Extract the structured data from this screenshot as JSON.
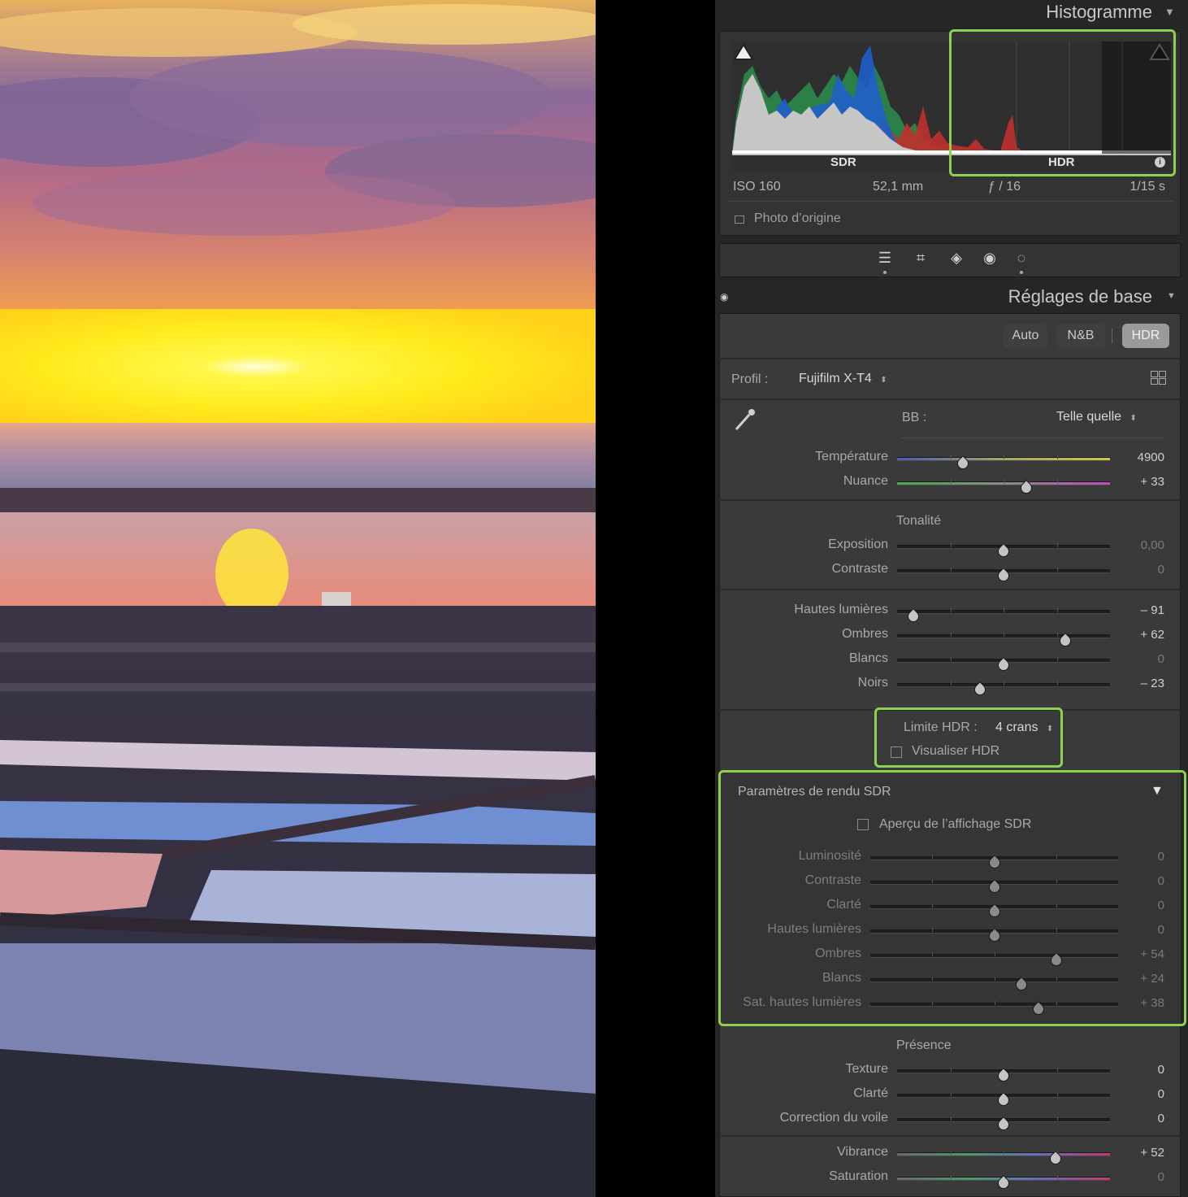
{
  "histogram": {
    "title": "Histogramme",
    "sdr_label": "SDR",
    "hdr_label": "HDR",
    "info": {
      "iso": "ISO 160",
      "focal": "52,1 mm",
      "aperture": "ƒ / 16",
      "shutter": "1/15 s"
    },
    "original_photo_label": "Photo d’origine"
  },
  "basic": {
    "title": "Réglages de base",
    "buttons": [
      "Auto",
      "N&B",
      "HDR"
    ],
    "profile_label": "Profil :",
    "profile_value": "Fujifilm X-T4",
    "wb_label": "BB :",
    "wb_value": "Telle quelle",
    "wb_sliders": [
      {
        "label": "Température",
        "value": "4900",
        "pos": 0.31
      },
      {
        "label": "Nuance",
        "value": "+ 33",
        "pos": 0.605
      }
    ],
    "tone_title": "Tonalité",
    "tone_sliders": [
      {
        "label": "Exposition",
        "value": "0,00",
        "pos": 0.5,
        "dim_value": true
      },
      {
        "label": "Contraste",
        "value": "0",
        "pos": 0.5,
        "dim_value": true
      }
    ],
    "tone2_sliders": [
      {
        "label": "Hautes lumières",
        "value": "– 91",
        "pos": 0.075
      },
      {
        "label": "Ombres",
        "value": "+ 62",
        "pos": 0.79
      },
      {
        "label": "Blancs",
        "value": "0",
        "pos": 0.5,
        "dim_value": true
      },
      {
        "label": "Noirs",
        "value": "– 23",
        "pos": 0.39
      }
    ],
    "hdr_limit_label": "Limite HDR :",
    "hdr_limit_value": "4 crans",
    "visualize_hdr": "Visualiser HDR",
    "sdr_render_title": "Paramètres de rendu SDR",
    "sdr_preview": "Aperçu de l’affichage SDR",
    "sdr_sliders": [
      {
        "label": "Luminosité",
        "value": "0",
        "pos": 0.5
      },
      {
        "label": "Contraste",
        "value": "0",
        "pos": 0.5
      },
      {
        "label": "Clarté",
        "value": "0",
        "pos": 0.5
      },
      {
        "label": "Hautes lumières",
        "value": "0",
        "pos": 0.5
      },
      {
        "label": "Ombres",
        "value": "+ 54",
        "pos": 0.75
      },
      {
        "label": "Blancs",
        "value": "+ 24",
        "pos": 0.61
      },
      {
        "label": "Sat. hautes lumières",
        "value": "+ 38",
        "pos": 0.68
      }
    ],
    "presence_title": "Présence",
    "presence_sliders": [
      {
        "label": "Texture",
        "value": "0",
        "pos": 0.5
      },
      {
        "label": "Clarté",
        "value": "0",
        "pos": 0.5
      },
      {
        "label": "Correction du voile",
        "value": "0",
        "pos": 0.5
      }
    ],
    "color_sliders": [
      {
        "label": "Vibrance",
        "value": "+ 52",
        "pos": 0.745
      },
      {
        "label": "Saturation",
        "value": "0",
        "pos": 0.5,
        "dim_value": true
      }
    ]
  },
  "tools": [
    "sliders-icon",
    "crop-icon",
    "eraser-icon",
    "redeye-icon",
    "mask-icon"
  ]
}
